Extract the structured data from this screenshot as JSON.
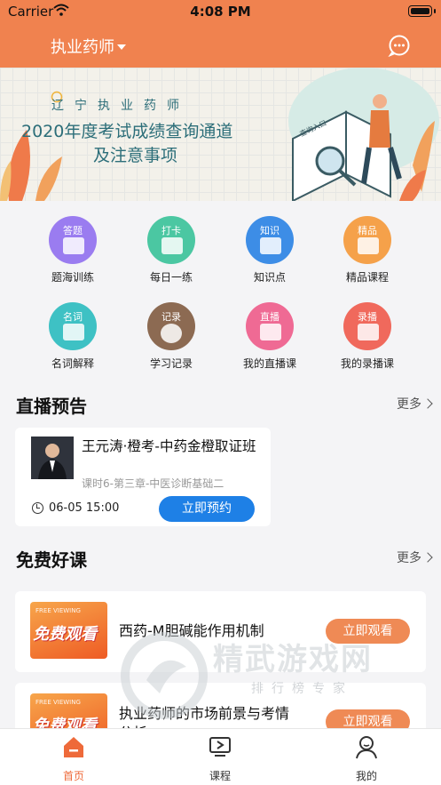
{
  "status_bar": {
    "carrier": "Carrier",
    "time": "4:08 PM"
  },
  "nav": {
    "title": "执业药师",
    "chat_icon": "chat-bubble-icon"
  },
  "banner": {
    "line1": "辽宁执业药师",
    "line2": "2020年度考试成绩查询通道",
    "line3": "及注意事项",
    "book_label": "查询入口"
  },
  "menu": [
    {
      "tag": "答题",
      "label": "题海训练",
      "color": "#9a7cf0",
      "icon": "quiz-icon"
    },
    {
      "tag": "打卡",
      "label": "每日一练",
      "color": "#4bc7a2",
      "icon": "checkin-icon"
    },
    {
      "tag": "知识",
      "label": "知识点",
      "color": "#3d8de6",
      "icon": "knowledge-icon"
    },
    {
      "tag": "精品",
      "label": "精品课程",
      "color": "#f5a14a",
      "icon": "premium-course-icon"
    },
    {
      "tag": "名词",
      "label": "名词解释",
      "color": "#3ec1c4",
      "icon": "glossary-icon"
    },
    {
      "tag": "记录",
      "label": "学习记录",
      "color": "#8c6a52",
      "icon": "study-record-icon"
    },
    {
      "tag": "直播",
      "label": "我的直播课",
      "color": "#ef6a94",
      "icon": "live-class-icon"
    },
    {
      "tag": "录播",
      "label": "我的录播课",
      "color": "#f0695c",
      "icon": "recorded-class-icon"
    }
  ],
  "live_section": {
    "title": "直播预告",
    "more": "更多",
    "card": {
      "teacher_title": "王元涛·橙考-中药金橙取证班",
      "lesson": "课时6-第三章-中医诊断基础二",
      "datetime": "06-05 15:00",
      "button": "立即预约"
    }
  },
  "free_section": {
    "title": "免费好课",
    "more": "更多",
    "courses": [
      {
        "thumb_small": "FREE VIEWING",
        "thumb_big": "免费观看",
        "name": "西药-M胆碱能作用机制",
        "button": "立即观看"
      },
      {
        "thumb_small": "FREE VIEWING",
        "thumb_big": "免费观看",
        "name": "执业药师的市场前景与考情分析",
        "button": "立即观看"
      }
    ]
  },
  "watermark": {
    "text": "精武游戏网",
    "sub": "排行榜专家"
  },
  "tabbar": [
    {
      "label": "首页",
      "icon": "home-icon",
      "active": true
    },
    {
      "label": "课程",
      "icon": "course-screen-icon",
      "active": false
    },
    {
      "label": "我的",
      "icon": "profile-icon",
      "active": false
    }
  ],
  "colors": {
    "brand": "#f0824f",
    "button_blue": "#1e80e6",
    "watch_button": "#ef8a55",
    "active_tab": "#ee6a3a"
  }
}
